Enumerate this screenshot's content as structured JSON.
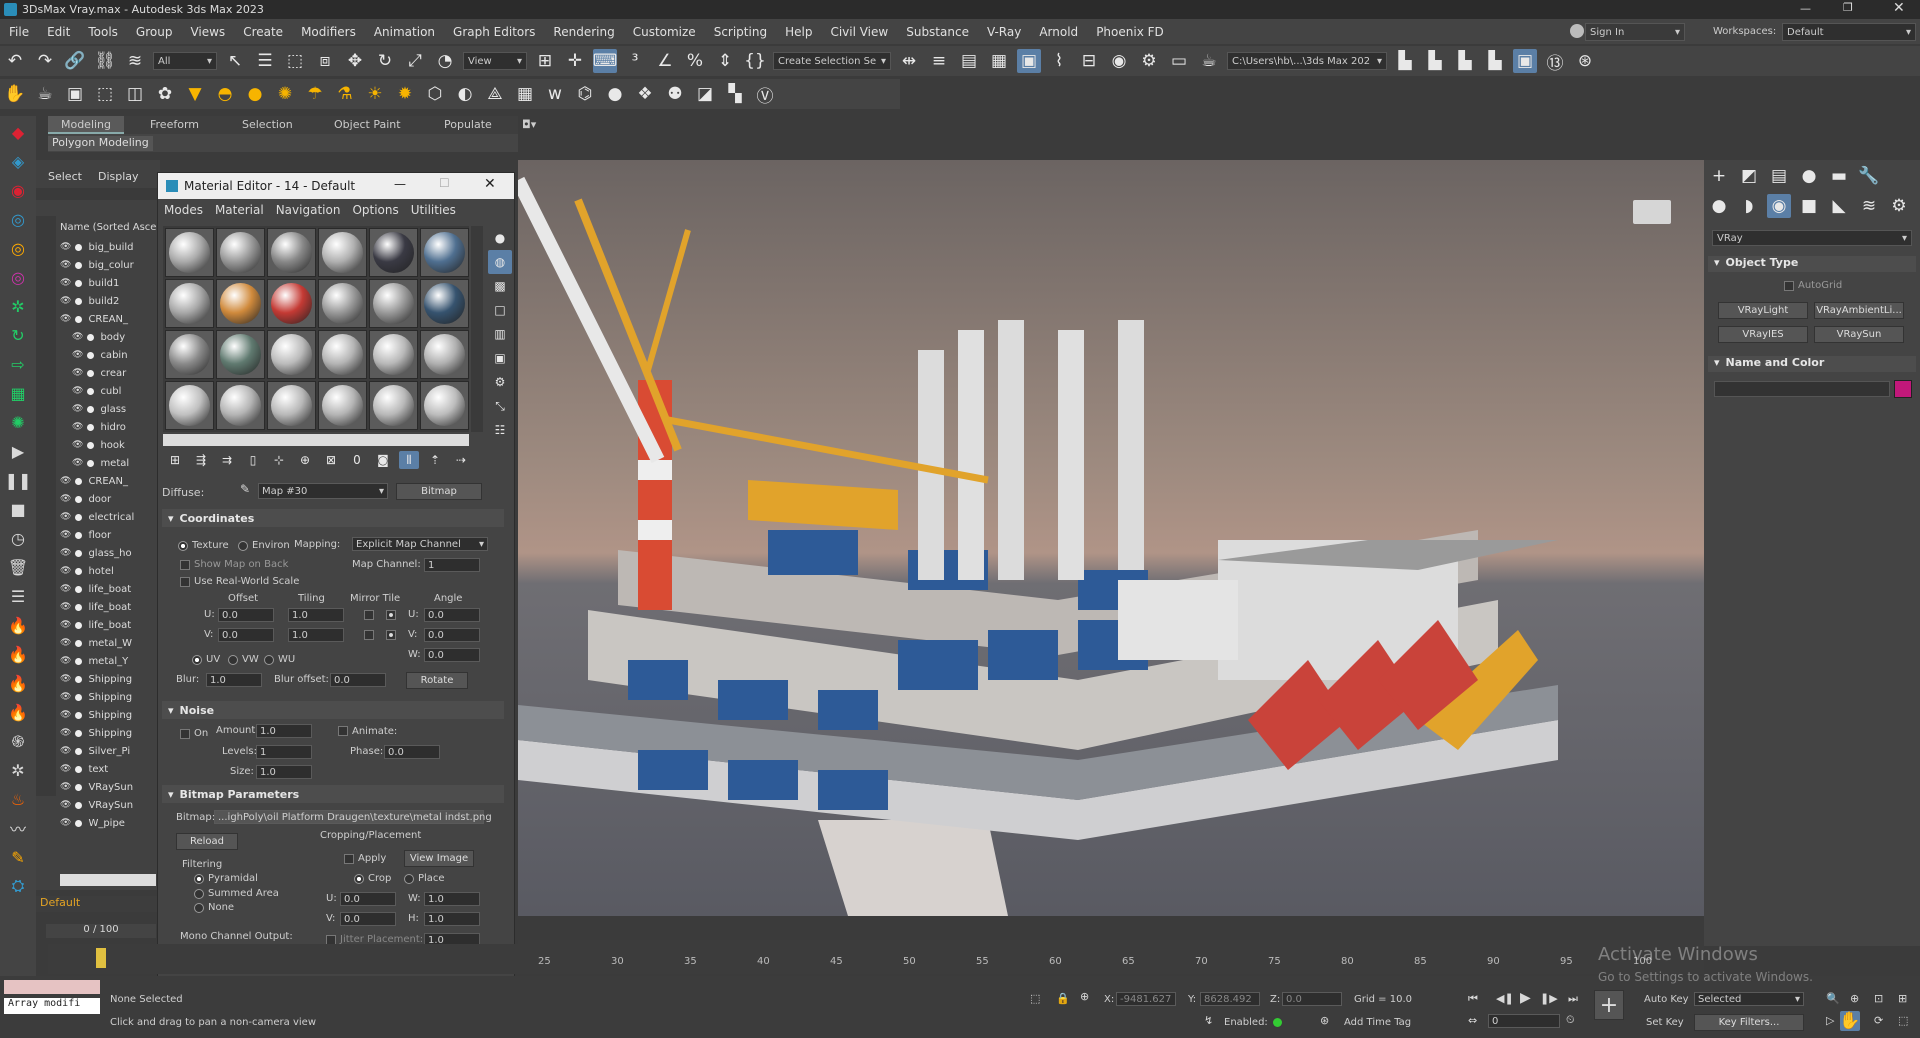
{
  "titlebar": {
    "title": "3DsMax Vray.max - Autodesk 3ds Max 2023"
  },
  "menu": [
    "File",
    "Edit",
    "Tools",
    "Group",
    "Views",
    "Create",
    "Modifiers",
    "Animation",
    "Graph Editors",
    "Rendering",
    "Customize",
    "Scripting",
    "Help",
    "Civil View",
    "Substance",
    "V-Ray",
    "Arnold",
    "Phoenix FD"
  ],
  "account": {
    "signin": "Sign In",
    "workspaces_label": "Workspaces:",
    "workspace": "Default"
  },
  "toolbar": {
    "filter": "All",
    "view": "View",
    "selection_set": "Create Selection Se",
    "path": "C:\\Users\\hb\\...\\3ds Max 202"
  },
  "ribbon": {
    "tabs": [
      "Modeling",
      "Freeform",
      "Selection",
      "Object Paint",
      "Populate"
    ],
    "sub": "Polygon Modeling"
  },
  "scene": {
    "tabs": [
      "Select",
      "Display"
    ],
    "header": "Name (Sorted Asce",
    "items": [
      "big_build",
      "big_colur",
      "build1",
      "build2",
      "CREAN_",
      "body",
      "cabin",
      "crear",
      "cubl",
      "glass",
      "hidro",
      "hook",
      "metal",
      "CREAN_",
      "door",
      "electrical",
      "floor",
      "glass_ho",
      "hotel",
      "life_boat",
      "life_boat",
      "life_boat",
      "metal_W",
      "metal_Y",
      "Shipping",
      "Shipping",
      "Shipping",
      "Shipping",
      "Silver_Pi",
      "text",
      "VRaySun",
      "VRaySun",
      "W_pipe"
    ],
    "layer": "Default",
    "frames": "0 / 100"
  },
  "material_editor": {
    "title": "Material Editor - 14 - Default",
    "menu": [
      "Modes",
      "Material",
      "Navigation",
      "Options",
      "Utilities"
    ],
    "diffuse_label": "Diffuse:",
    "map_name": "Map #30",
    "map_type": "Bitmap",
    "coordinates": {
      "title": "Coordinates",
      "texture": "Texture",
      "environ": "Environ",
      "mapping_label": "Mapping:",
      "mapping": "Explicit Map Channel",
      "show_map": "Show Map on Back",
      "map_channel_label": "Map Channel:",
      "map_channel": "1",
      "real_world": "Use Real-World Scale",
      "h_offset": "Offset",
      "h_tiling": "Tiling",
      "h_mirror": "Mirror Tile",
      "h_angle": "Angle",
      "u": "U:",
      "v": "V:",
      "w": "W:",
      "u_offset": "0.0",
      "u_tiling": "1.0",
      "u_angle": "0.0",
      "v_offset": "0.0",
      "v_tiling": "1.0",
      "v_angle": "0.0",
      "w_angle": "0.0",
      "uv": "UV",
      "vw": "VW",
      "wu": "WU",
      "blur_label": "Blur:",
      "blur": "1.0",
      "blur_offset_label": "Blur offset:",
      "blur_offset": "0.0",
      "rotate": "Rotate"
    },
    "noise": {
      "title": "Noise",
      "on": "On",
      "amount_label": "Amount:",
      "amount": "1.0",
      "levels_label": "Levels:",
      "levels": "1",
      "size_label": "Size:",
      "size": "1.0",
      "animate": "Animate:",
      "phase_label": "Phase:",
      "phase": "0.0"
    },
    "bitmap": {
      "title": "Bitmap Parameters",
      "bitmap_label": "Bitmap:",
      "path": "...ighPoly\\oil Platform Draugen\\texture\\metal indst.png",
      "reload": "Reload",
      "crop_title": "Cropping/Placement",
      "apply": "Apply",
      "view_image": "View Image",
      "crop": "Crop",
      "place": "Place",
      "filtering": "Filtering",
      "pyramidal": "Pyramidal",
      "summed": "Summed Area",
      "none": "None",
      "u_label": "U:",
      "u": "0.0",
      "w_label": "W:",
      "w": "1.0",
      "v_label": "V:",
      "v": "0.0",
      "h_label": "H:",
      "h": "1.0",
      "mono": "Mono Channel Output:",
      "jitter": "Jitter Placement:",
      "jitter_val": "1.0"
    }
  },
  "command_panel": {
    "renderer": "VRay",
    "object_type": "Object Type",
    "autogrid": "AutoGrid",
    "buttons": [
      "VRayLight",
      "VRayAmbientLi...",
      "VRayIES",
      "VRaySun"
    ],
    "name_color": "Name and Color",
    "color": "#c2187a"
  },
  "viewport": {
    "ticks": [
      "25",
      "30",
      "35",
      "40",
      "45",
      "50",
      "55",
      "60",
      "65",
      "70",
      "75",
      "80",
      "85",
      "90",
      "95",
      "100"
    ],
    "watermark1": "Activate Windows",
    "watermark2": "Go to Settings to activate Windows."
  },
  "status": {
    "script": "Array modifi",
    "selection": "None Selected",
    "hint": "Click and drag to pan a non-camera view",
    "x_label": "X:",
    "x": "-9481.627",
    "y_label": "Y:",
    "y": "8628.492",
    "z_label": "Z:",
    "z": "0.0",
    "grid": "Grid = 10.0",
    "enabled": "Enabled:",
    "add_tag": "Add Time Tag",
    "frame": "0",
    "autokey": "Auto Key",
    "setkey": "Set Key",
    "selected": "Selected",
    "key_filters": "Key Filters..."
  }
}
